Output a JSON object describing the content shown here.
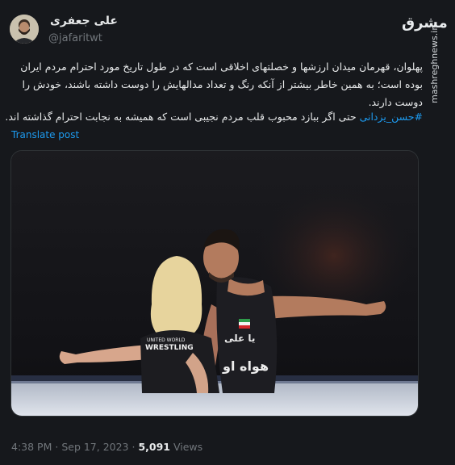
{
  "author": {
    "display_name": "علی جعفری",
    "handle": "@jafaritwt"
  },
  "source": {
    "logo_text": "مشرق",
    "side_text": "mashreghnews.ir"
  },
  "tweet": {
    "text_main": "پهلوان، قهرمان میدان ارزشها و خصلتهای اخلاقی است که در طول تاریخ مورد احترام مردم ایران بوده است؛ به همین خاطر بیشتر از آنکه رنگ و تعداد مدالهایش را دوست داشته باشند، خودش را دوست دارند.",
    "hashtag": "#حسن_یزدانی",
    "text_after_hashtag": "حتی اگر ببازد محبوب قلب مردم نجیبی است که همیشه به نجابت احترام گذاشته اند.",
    "translate_label": "Translate post"
  },
  "media": {
    "jersey_text_1": "یا علی",
    "jersey_text_2": "هواه او",
    "ref_shirt_line_1": "UNITED WORLD",
    "ref_shirt_line_2": "WRESTLING"
  },
  "meta": {
    "time": "4:38 PM",
    "date": "Sep 17, 2023",
    "views_count": "5,091",
    "views_label": "Views"
  }
}
